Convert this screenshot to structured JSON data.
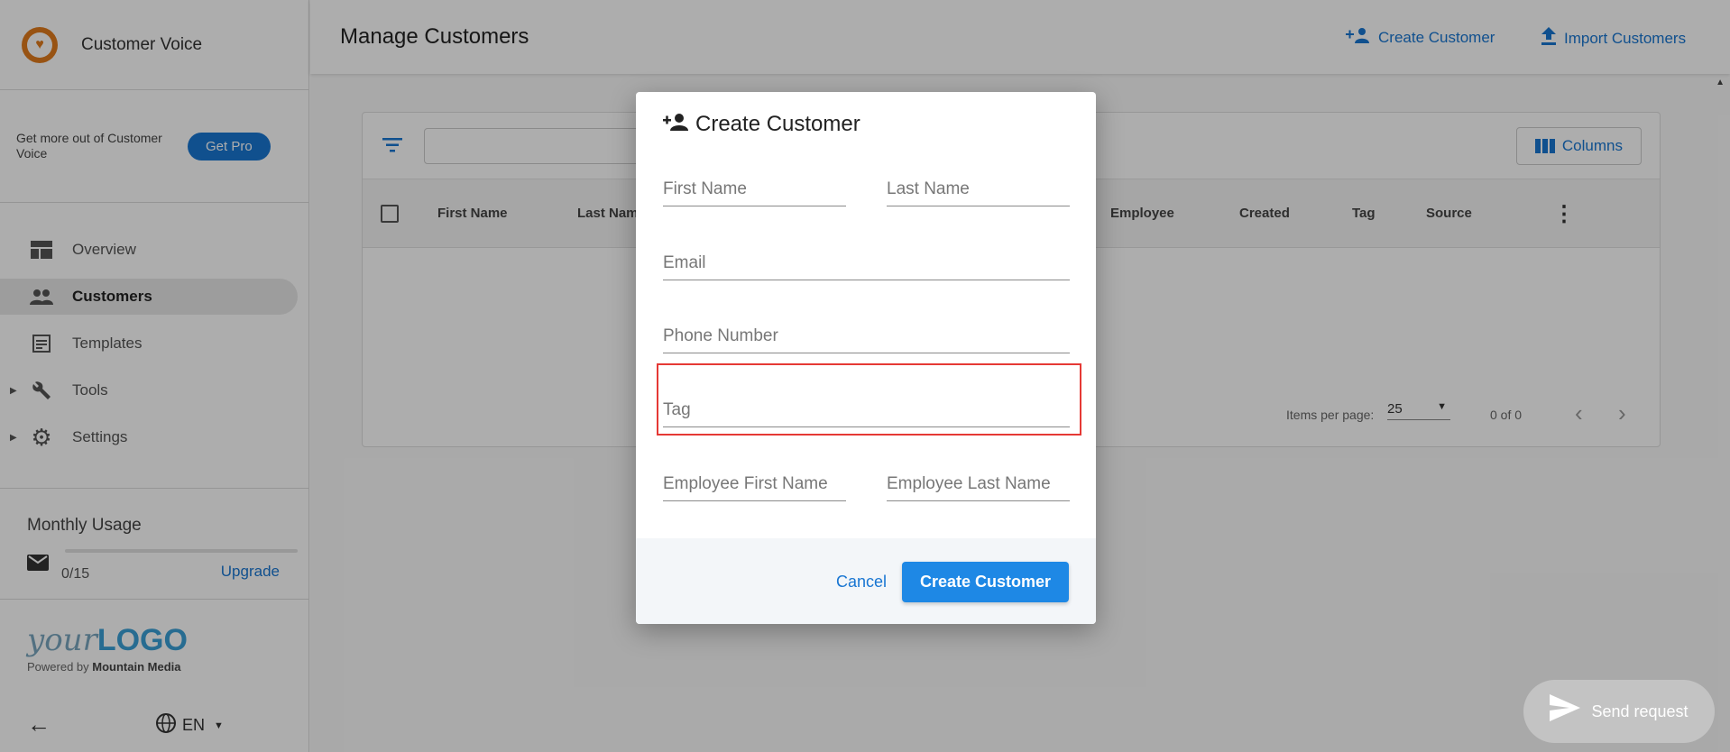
{
  "brand": {
    "name": "Customer Voice",
    "logo_glyph": "♥"
  },
  "promo": {
    "text": "Get more out of Customer Voice",
    "button": "Get Pro"
  },
  "nav": [
    {
      "label": "Overview",
      "icon": "dashboard-icon",
      "glyph": "▬",
      "active": false
    },
    {
      "label": "Customers",
      "icon": "people-icon",
      "glyph": "👥",
      "active": true
    },
    {
      "label": "Templates",
      "icon": "template-icon",
      "glyph": "▤",
      "active": false
    },
    {
      "label": "Tools",
      "icon": "wrench-icon",
      "glyph": "🔧",
      "active": false,
      "expandable": true
    },
    {
      "label": "Settings",
      "icon": "gear-icon",
      "glyph": "⚙",
      "active": false,
      "expandable": true
    }
  ],
  "usage": {
    "title": "Monthly Usage",
    "count": "0/15",
    "upgrade": "Upgrade",
    "fraction": 0
  },
  "footer": {
    "logo_your": "your",
    "logo_logo": "LOGO",
    "powered_prefix": "Powered by",
    "powered_company": "Mountain Media",
    "language": "EN"
  },
  "header": {
    "title": "Manage Customers",
    "create_customer": "Create Customer",
    "import_customers": "Import Customers"
  },
  "table": {
    "columns_button": "Columns",
    "headers": [
      "First Name",
      "Last Name",
      "Employee",
      "Created",
      "Tag",
      "Source"
    ],
    "items_per_page_label": "Items per page:",
    "items_per_page": "25",
    "range": "0 of 0"
  },
  "modal": {
    "title": "Create Customer",
    "fields": {
      "first_name": "First Name",
      "last_name": "Last Name",
      "email": "Email",
      "phone": "Phone Number",
      "tag": "Tag",
      "employee_first_name": "Employee First Name",
      "employee_last_name": "Employee Last Name"
    },
    "cancel": "Cancel",
    "submit": "Create Customer"
  },
  "send_request": "Send request",
  "colors": {
    "accent": "#1976d2",
    "highlight": "#e53935",
    "brand_orange": "#e07b1d"
  }
}
